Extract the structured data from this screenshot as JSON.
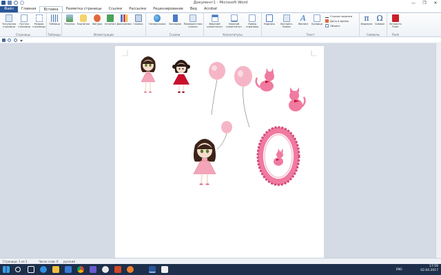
{
  "window": {
    "title": "Документ1 - Microsoft Word",
    "controls": [
      "—",
      "❐",
      "✕"
    ]
  },
  "tabs": [
    "Файл",
    "Главная",
    "Вставка",
    "Разметка страницы",
    "Ссылки",
    "Рассылки",
    "Рецензирование",
    "Вид",
    "Acrobat"
  ],
  "ribbon": {
    "groups": {
      "pages": "Страницы",
      "tables": "Таблицы",
      "illustrations": "Иллюстрации",
      "links": "Ссылки",
      "headers": "Колонтитулы",
      "text": "Текст",
      "symbols": "Символы",
      "flash": "Flash"
    },
    "buttons": {
      "cover": "Титульная страница",
      "blank": "Пустая страница",
      "break": "Разрыв страницы",
      "table": "Таблица",
      "picture": "Рисунок",
      "clipart": "Картинка",
      "shapes": "Фигуры",
      "smartart": "SmartArt",
      "chart": "Диаграмма",
      "screenshot": "Снимок",
      "hyperlink": "Гиперссылка",
      "bookmark": "Закладка",
      "crossref": "Перекрестная ссылка",
      "header": "Верхний колонтитул",
      "footer": "Нижний колонтитул",
      "pagenum": "Номер страницы",
      "textbox": "Надпись",
      "expressblocks": "Экспресс-блоки",
      "wordart": "WordArt",
      "dropcap": "Буквица",
      "formula": "Формула",
      "symbol": "Символ",
      "flash": "Встроить Flash"
    },
    "small": {
      "sigline": "Строка подписи",
      "datetime": "Дата и время",
      "object": "Объект"
    },
    "glyphs": {
      "formula": "π",
      "symbol": "Ω",
      "wordart": "A"
    }
  },
  "status": {
    "page": "Страница: 1 из 1",
    "words": "Число слов: 0",
    "lang": "русский"
  },
  "tray": {
    "lang": "ENG",
    "time": "17:59",
    "date": "02.04.2017"
  },
  "colors": {
    "file_tab": "#2a5699",
    "taskbar": "#1d2f4a",
    "workspace": "#d5dbe5",
    "pink": "#f07aa0",
    "red_dress": "#c8102e"
  }
}
